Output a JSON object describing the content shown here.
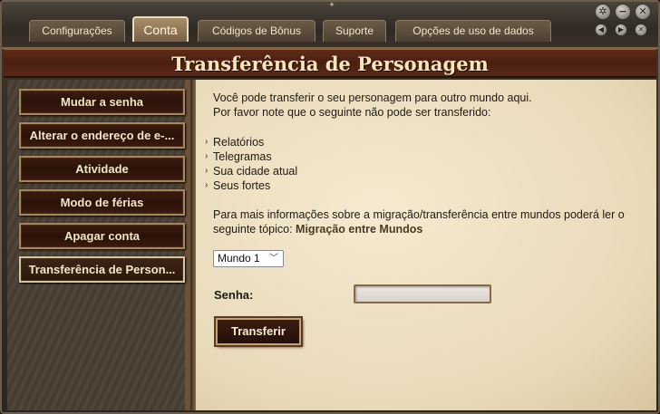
{
  "tabs": [
    {
      "label": "Configurações"
    },
    {
      "label": "Conta"
    },
    {
      "label": "Códigos de Bônus"
    },
    {
      "label": "Suporte"
    },
    {
      "label": "Opções de uso de dados"
    }
  ],
  "page_title": "Transferência de Personagem",
  "sidebar": {
    "items": [
      {
        "label": "Mudar a senha"
      },
      {
        "label": "Alterar o endereço de e-..."
      },
      {
        "label": "Atividade"
      },
      {
        "label": "Modo de férias"
      },
      {
        "label": "Apagar conta"
      },
      {
        "label": "Transferência de Person..."
      }
    ]
  },
  "content": {
    "intro_line1": "Você pode transferir o seu personagem para outro mundo aqui.",
    "intro_line2": "Por favor note que o seguinte não pode ser transferido:",
    "bullets": [
      "Relatórios",
      "Telegramas",
      "Sua cidade atual",
      "Seus fortes"
    ],
    "more_info_line1": "Para mais informações sobre a migração/transferência entre mundos poderá ler o",
    "more_info_line2_prefix": "seguinte tópico:",
    "more_info_link": "Migração entre Mundos",
    "world_select_value": "Mundo 1",
    "password_label": "Senha:",
    "password_value": "",
    "transfer_button": "Transferir"
  },
  "icons": {
    "close": "close-icon",
    "minimize": "minimize-icon",
    "settings": "gear-icon",
    "nav_back": "arrow-left-icon",
    "nav_forward": "arrow-right-icon",
    "nav_close": "close-small-icon"
  },
  "colors": {
    "title_bar": "#4a1f12",
    "title_text": "#f6e6b8",
    "sidebar_button": "#2a1208",
    "parchment": "#f0e4c8"
  }
}
